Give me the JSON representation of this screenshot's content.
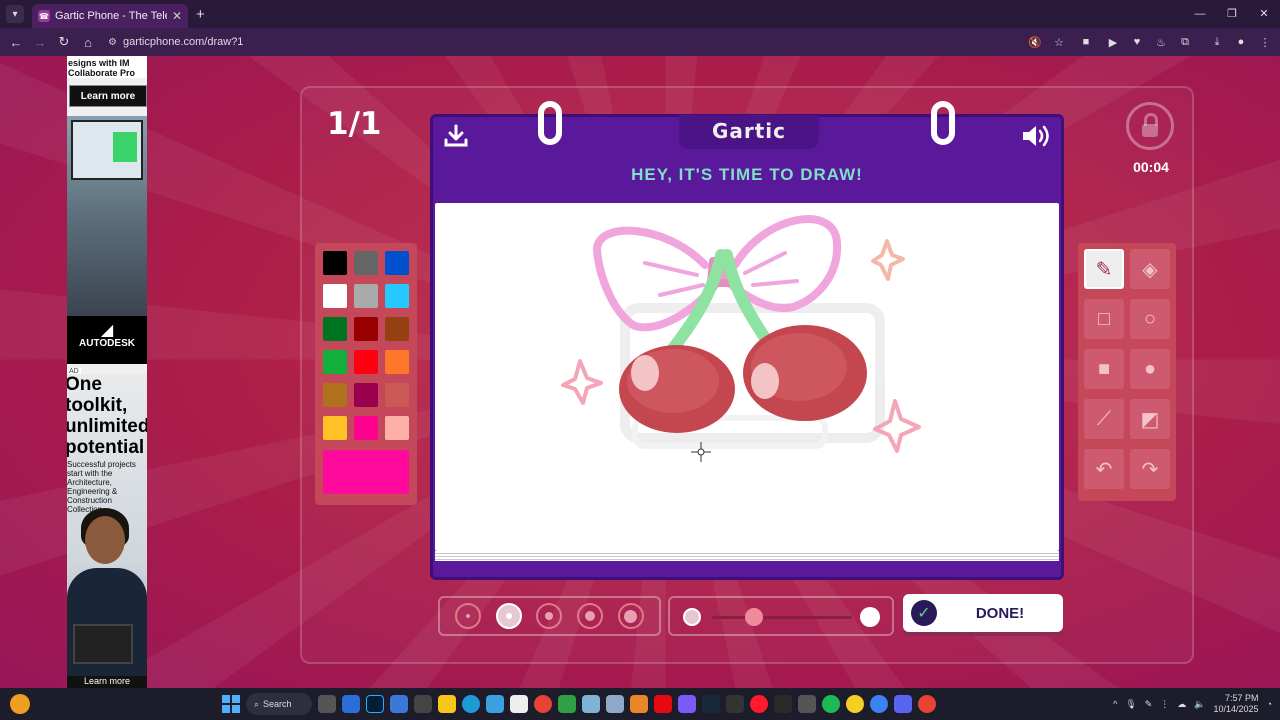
{
  "browser": {
    "tab_title": "Gartic Phone - The Telephone G",
    "tab_close": "✕",
    "new_tab": "+",
    "url": "garticphone.com/draw?1",
    "window_controls": [
      "—",
      "❐",
      "✕"
    ]
  },
  "ad": {
    "top_text": "esigns with IM Collaborate Pro",
    "learn_more": "Learn more",
    "brand": "AUTODESK",
    "ad_label": "AD",
    "headline": "One toolkit, unlimited potential",
    "body": "Successful projects start with the Architecture, Engineering & Construction Collection.",
    "learn_more_bottom": "Learn more"
  },
  "game": {
    "round": "1/1",
    "logo": "Gartic",
    "prompt": "HEY, IT'S TIME TO DRAW!",
    "timer": "00:04",
    "done_label": "DONE!",
    "selected_color": "#ff0a9c",
    "palette": [
      "#000000",
      "#666666",
      "#0050cd",
      "#ffffff",
      "#aaaaaa",
      "#26c9ff",
      "#017420",
      "#990000",
      "#964112",
      "#11b03c",
      "#ff0013",
      "#ff7829",
      "#b0701c",
      "#99004e",
      "#cb5a57",
      "#ffc126",
      "#ff008f",
      "#feafa8"
    ],
    "tools": [
      "pen-icon",
      "eraser-icon",
      "square-outline-icon",
      "circle-outline-icon",
      "square-fill-icon",
      "circle-fill-icon",
      "line-icon",
      "bucket-icon",
      "undo-icon",
      "redo-icon"
    ],
    "brush_sizes": 5,
    "active_brush_size": 2,
    "opacity": 0.3
  },
  "taskbar": {
    "search": "Search",
    "time": "7:57 PM",
    "date": "10/14/2025"
  }
}
